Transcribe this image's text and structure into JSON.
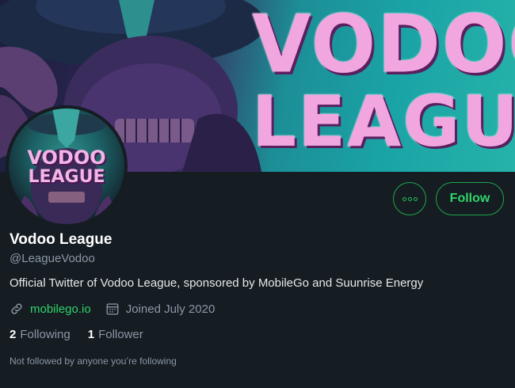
{
  "banner": {
    "title_line1": "VODOO",
    "title_line2": "LEAGUE"
  },
  "avatar": {
    "line1": "VODOO",
    "line2": "LEAGUE"
  },
  "actions": {
    "more_icon": "more-options-icon",
    "follow_label": "Follow"
  },
  "profile": {
    "display_name": "Vodoo League",
    "handle": "@LeagueVodoo",
    "bio": "Official Twitter of Vodoo League, sponsored by MobileGo and Suunrise Energy",
    "website": "mobilego.io",
    "joined": "Joined July 2020",
    "following_count": "2",
    "following_label": "Following",
    "follower_count": "1",
    "follower_label": "Follower",
    "not_followed_text": "Not followed by anyone you’re following"
  },
  "colors": {
    "accent": "#2fd46a",
    "background": "#151c22",
    "muted": "#8b98a5"
  }
}
